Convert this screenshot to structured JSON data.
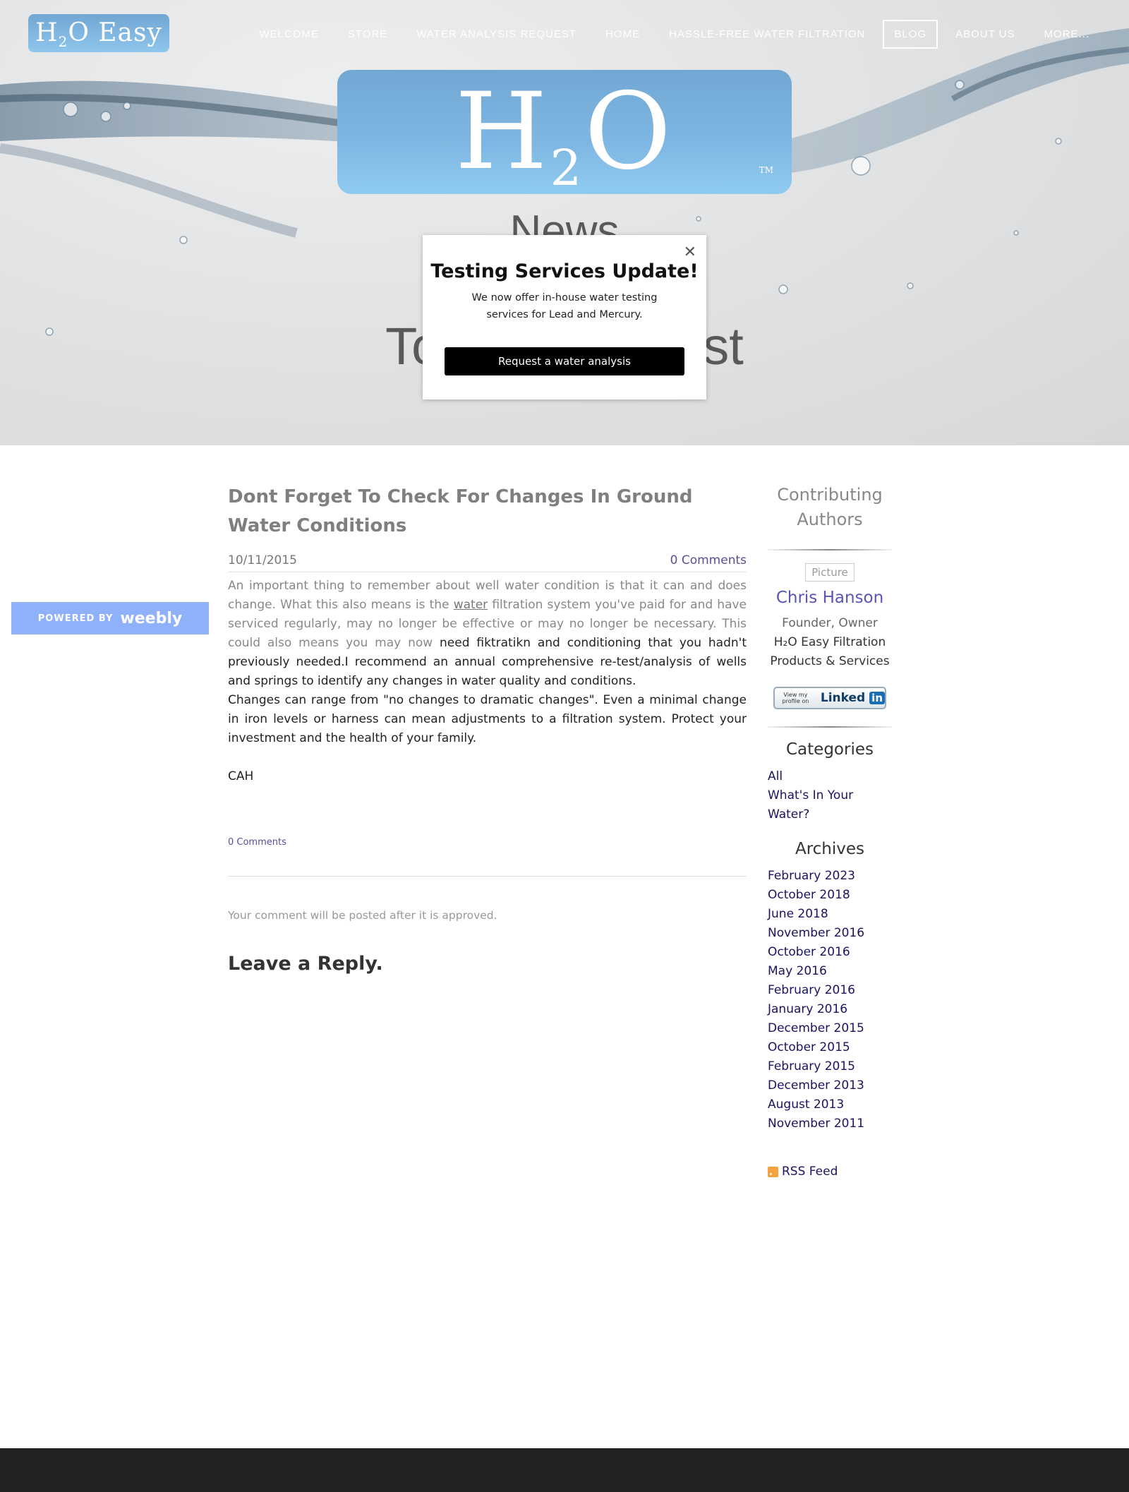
{
  "brand": {
    "logo_main": "H",
    "logo_sub": "2",
    "logo_rest": "O Easy",
    "tm": "TM"
  },
  "nav": {
    "items": [
      "WELCOME",
      "STORE",
      "WATER ANALYSIS REQUEST",
      "HOME",
      "HASSLE-FREE WATER FILTRATION",
      "BLOG",
      "ABOUT US",
      "MORE..."
    ],
    "active": "BLOG"
  },
  "hero": {
    "title1": "News",
    "title2": "To",
    "title2_end": "st"
  },
  "popup": {
    "close": "✕",
    "title": "Testing Services Update!",
    "body": "We now offer in-house water testing services for Lead and Mercury.",
    "button": "Request a water analysis"
  },
  "weebly": {
    "powered_by": "POWERED BY",
    "brand": "weebly"
  },
  "post": {
    "title": "Dont Forget To Check For Changes In Ground Water Conditions",
    "date": "10/11/2015",
    "comments": "0 Comments",
    "para1_grey_a": "An important thing to remember about well water condition is that it can and does change. What this also means is the",
    "para1_link": "water",
    "para1_grey_b": "filtration system you've paid for and have serviced regularly, may no longer be effective or may no longer be necessary. This could also means you may now",
    "para1_dark": "need fiktratikn and conditioning that you hadn't previously needed.I recommend an annual comprehensive re-test/analysis of wells and springs to identify any changes in water quality and conditions.",
    "para2": "Changes can range from \"no changes to dramatic changes\". Even a minimal change in iron levels or harness can mean adjustments to a filtration system. Protect your investment and the health of your family.",
    "signature": "CAH",
    "comments_small": "0 Comments",
    "notice": "Your comment will be posted after it is approved.",
    "reply_heading": "Leave a Reply."
  },
  "sidebar": {
    "contrib_heading": "Contributing Authors",
    "picture_alt": "Picture",
    "author": "Chris Hanson",
    "role": "Founder, Owner",
    "company": "H₂O Easy Filtration Products & Services",
    "linkedin_view": "View my profile on",
    "linkedin_brand": "Linked",
    "linkedin_in": "in",
    "categories_heading": "Categories",
    "categories": [
      "All",
      "What's In Your Water?"
    ],
    "archives_heading": "Archives",
    "archives": [
      "February 2023",
      "October 2018",
      "June 2018",
      "November 2016",
      "October 2016",
      "May 2016",
      "February 2016",
      "January 2016",
      "December 2015",
      "October 2015",
      "February 2015",
      "December 2013",
      "August 2013",
      "November 2011"
    ],
    "rss": "RSS Feed"
  },
  "colors": {
    "accent": "#5a55b4",
    "link_dark": "#1a1460",
    "logo_blue": "#7fb7e2",
    "footer": "#222222",
    "weebly": "#8fb1f9"
  }
}
